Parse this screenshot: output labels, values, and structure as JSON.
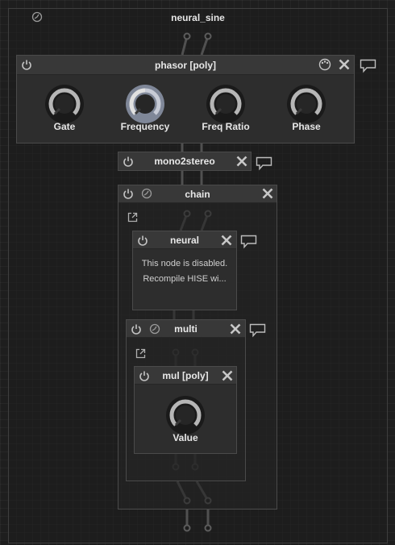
{
  "root": {
    "title": "neural_sine"
  },
  "phasor": {
    "title": "phasor [poly]",
    "knobs": [
      {
        "label": "Gate",
        "value": 0.0
      },
      {
        "label": "Frequency",
        "value": 0.5
      },
      {
        "label": "Freq Ratio",
        "value": 0.0
      },
      {
        "label": "Phase",
        "value": 0.0
      }
    ]
  },
  "mono2stereo": {
    "title": "mono2stereo"
  },
  "chain": {
    "title": "chain"
  },
  "neural": {
    "title": "neural",
    "message_line1": "This node is disabled.",
    "message_line2": "Recompile HISE wi..."
  },
  "multi": {
    "title": "multi"
  },
  "mul": {
    "title": "mul [poly]",
    "knob": {
      "label": "Value",
      "value": 0.0
    }
  },
  "colors": {
    "background": "#1e1e1e",
    "panel": "#2d2d2d",
    "header": "#383838",
    "knob_arc": "#b4b4b4",
    "knob_active": "#9aa0b0"
  }
}
